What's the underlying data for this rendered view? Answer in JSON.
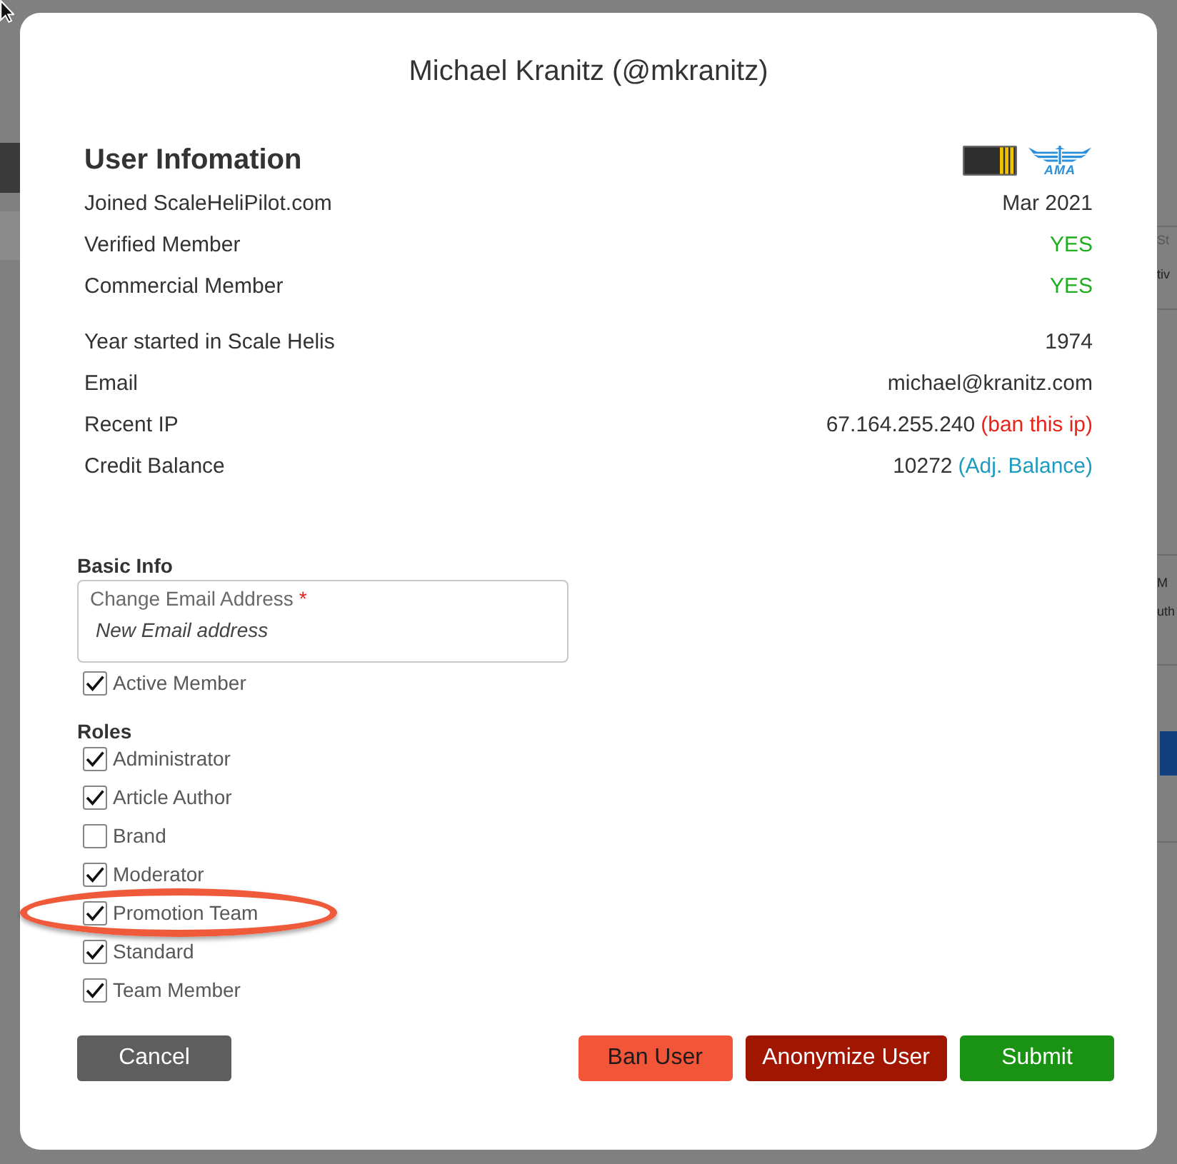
{
  "background_page": {
    "right_edge": [
      {
        "lines": [
          "St",
          "tiv"
        ]
      },
      {
        "lines": [
          "M",
          "uth"
        ]
      }
    ]
  },
  "dialog": {
    "title": "Michael Kranitz (@mkranitz)"
  },
  "info": {
    "title": "User Infomation",
    "badges": [
      {
        "kind": "stripes"
      },
      {
        "kind": "wings",
        "text": "AMA"
      }
    ],
    "groups": [
      {
        "rows": [
          {
            "label": "Joined ScaleHeliPilot.com",
            "value": "Mar 2021",
            "kind": "plain"
          },
          {
            "label": "Verified Member",
            "value": "YES",
            "kind": "flag"
          },
          {
            "label": "Commercial Member",
            "value": "YES",
            "kind": "flag"
          }
        ]
      },
      {
        "rows": [
          {
            "label": "Year started in Scale Helis",
            "value": "1974",
            "kind": "plain"
          },
          {
            "label": "Email",
            "value": "michael@kranitz.com",
            "kind": "plain"
          },
          {
            "label": "Recent IP",
            "value": "67.164.255.240",
            "kind": "plain",
            "link": {
              "label": "(ban this ip)",
              "kind": "danger"
            }
          },
          {
            "label": "Credit Balance",
            "value": "10272",
            "kind": "plain",
            "link": {
              "label": "(Adj. Balance)",
              "kind": "info"
            }
          }
        ]
      }
    ]
  },
  "basic_info": {
    "title": "Basic Info",
    "email_field": {
      "label": "Change Email Address",
      "required_mark": "*",
      "placeholder": "New Email address"
    },
    "options": [
      {
        "label": "Active Member",
        "checked": true
      }
    ]
  },
  "roles": {
    "title": "Roles",
    "items": [
      {
        "label": "Administrator",
        "checked": true,
        "highlighted": false
      },
      {
        "label": "Article Author",
        "checked": true,
        "highlighted": false
      },
      {
        "label": "Brand",
        "checked": false,
        "highlighted": false
      },
      {
        "label": "Moderator",
        "checked": true,
        "highlighted": false
      },
      {
        "label": "Promotion Team",
        "checked": true,
        "highlighted": true
      },
      {
        "label": "Standard",
        "checked": true,
        "highlighted": false
      },
      {
        "label": "Team Member",
        "checked": true,
        "highlighted": false
      }
    ]
  },
  "footer": {
    "left": [
      {
        "label": "Cancel",
        "kind": "secondary"
      }
    ],
    "right": [
      {
        "label": "Ban User",
        "kind": "warning"
      },
      {
        "label": "Anonymize User",
        "kind": "danger"
      },
      {
        "label": "Submit",
        "kind": "success"
      }
    ]
  }
}
